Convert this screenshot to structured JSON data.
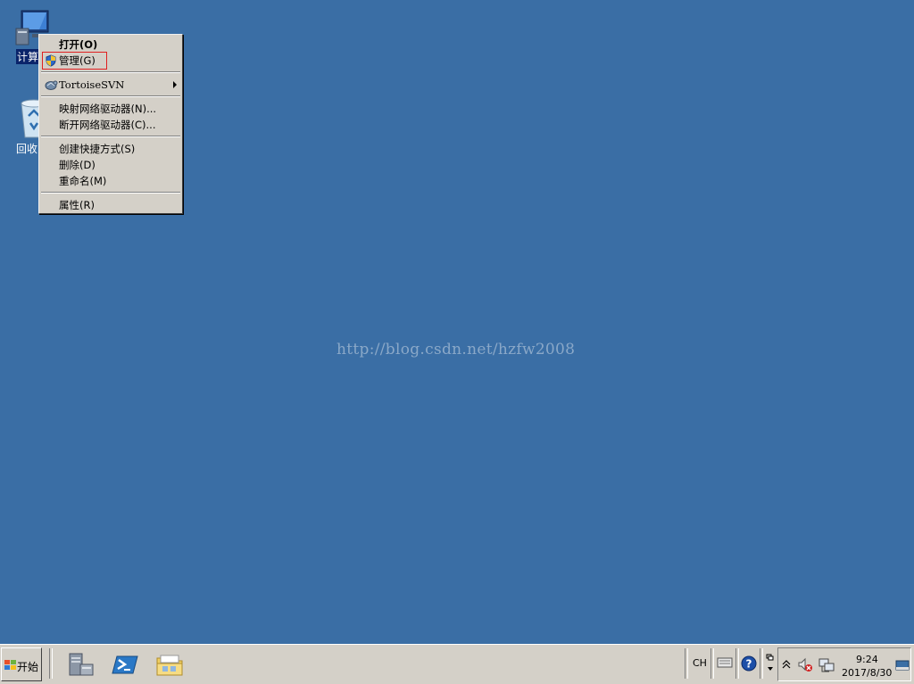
{
  "desktop": {
    "icons": [
      {
        "label": "计算"
      },
      {
        "label": "回收"
      }
    ],
    "watermark": "http://blog.csdn.net/hzfw2008"
  },
  "context_menu": {
    "items": [
      {
        "label": "打开(O)",
        "bold": true
      },
      {
        "label": "管理(G)",
        "icon": "shield-icon",
        "highlighted": true
      },
      {
        "label": "TortoiseSVN",
        "icon": "tortoisesvn-icon",
        "submenu": true
      },
      {
        "label": "映射网络驱动器(N)..."
      },
      {
        "label": "断开网络驱动器(C)..."
      },
      {
        "label": "创建快捷方式(S)"
      },
      {
        "label": "删除(D)"
      },
      {
        "label": "重命名(M)"
      },
      {
        "label": "属性(R)"
      }
    ]
  },
  "taskbar": {
    "start_label": "开始",
    "quick_launch": [
      "server-manager-icon",
      "powershell-icon",
      "explorer-icon"
    ],
    "language": "CH",
    "tray": {
      "time": "9:24",
      "date": "2017/8/30"
    }
  }
}
